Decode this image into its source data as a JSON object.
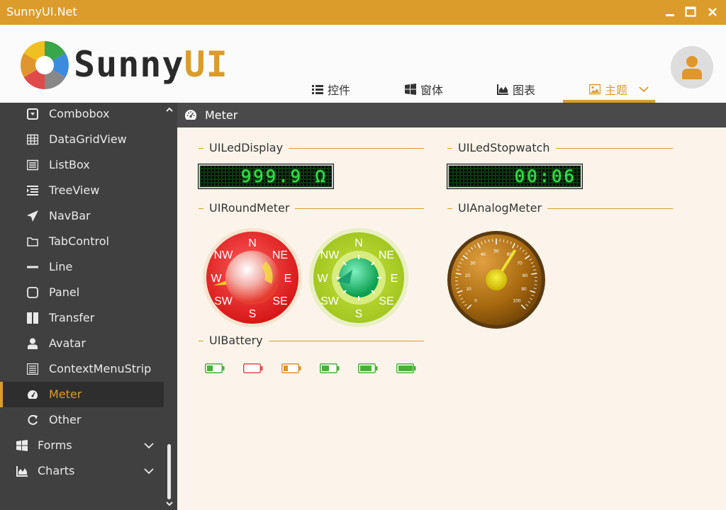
{
  "window": {
    "title": "SunnyUI.Net"
  },
  "brand": {
    "text_main": "Sunny",
    "text_accent": "UI"
  },
  "nav": [
    {
      "label": "控件",
      "icon": "list-icon"
    },
    {
      "label": "窗体",
      "icon": "windows-icon"
    },
    {
      "label": "图表",
      "icon": "area-chart-icon"
    },
    {
      "label": "主题",
      "icon": "image-icon",
      "active": true
    }
  ],
  "sidebar": {
    "items": [
      {
        "label": "Combobox",
        "icon": "combobox-icon"
      },
      {
        "label": "DataGridView",
        "icon": "grid-icon"
      },
      {
        "label": "ListBox",
        "icon": "listbox-icon"
      },
      {
        "label": "TreeView",
        "icon": "treeview-icon"
      },
      {
        "label": "NavBar",
        "icon": "paper-plane-icon"
      },
      {
        "label": "TabControl",
        "icon": "folder-icon"
      },
      {
        "label": "Line",
        "icon": "minus-icon"
      },
      {
        "label": "Panel",
        "icon": "square-icon"
      },
      {
        "label": "Transfer",
        "icon": "columns-icon"
      },
      {
        "label": "Avatar",
        "icon": "user-icon"
      },
      {
        "label": "ContextMenuStrip",
        "icon": "menu-icon"
      },
      {
        "label": "Meter",
        "icon": "dashboard-icon",
        "selected": true
      },
      {
        "label": "Other",
        "icon": "refresh-icon"
      }
    ],
    "groups": [
      {
        "label": "Forms",
        "icon": "windows-icon"
      },
      {
        "label": "Charts",
        "icon": "area-chart-icon"
      }
    ]
  },
  "page": {
    "title": "Meter"
  },
  "sections": {
    "led_display": "UILedDisplay",
    "led_stopwatch": "UILedStopwatch",
    "round_meter": "UIRoundMeter",
    "analog_meter": "UIAnalogMeter",
    "battery": "UIBattery"
  },
  "led_display_value": "999.9 Ω",
  "led_stopwatch_value": "00:06",
  "compass": {
    "labels": {
      "n": "N",
      "ne": "NE",
      "e": "E",
      "se": "SE",
      "s": "S",
      "sw": "SW",
      "w": "W",
      "nw": "NW"
    }
  },
  "analog_meter": {
    "ticks": [
      "0",
      "10",
      "20",
      "30",
      "40",
      "50",
      "60",
      "70",
      "80",
      "90",
      "100"
    ],
    "value": 62
  },
  "batteries": [
    {
      "level": 0.4,
      "color": "#4caf3a"
    },
    {
      "level": 0.0,
      "color": "#e05050"
    },
    {
      "level": 0.3,
      "color": "#e0902c"
    },
    {
      "level": 0.5,
      "color": "#4caf3a"
    },
    {
      "level": 0.8,
      "color": "#4caf3a"
    },
    {
      "level": 1.0,
      "color": "#4caf3a"
    }
  ],
  "colors": {
    "accent": "#dc9c2c",
    "sidebar": "#404040",
    "content_bg": "#fcf4ea"
  }
}
